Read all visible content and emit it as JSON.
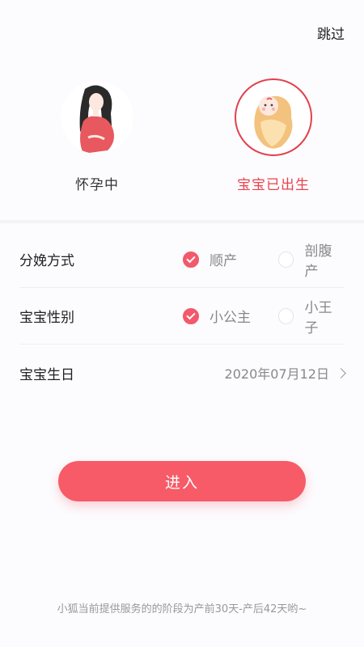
{
  "header": {
    "skip_label": "跳过"
  },
  "stages": {
    "pregnant": {
      "label": "怀孕中",
      "icon": "pregnant-woman-icon"
    },
    "born": {
      "label": "宝宝已出生",
      "icon": "swaddled-baby-icon"
    }
  },
  "form": {
    "delivery": {
      "label": "分娩方式",
      "option_a": "顺产",
      "option_b": "剖腹产",
      "selected": "顺产"
    },
    "gender": {
      "label": "宝宝性别",
      "option_a": "小公主",
      "option_b": "小王子",
      "selected": "小公主"
    },
    "birthday": {
      "label": "宝宝生日",
      "value": "2020年07月12日"
    }
  },
  "enter_label": "进入",
  "footer_text": "小狐当前提供服务的的阶段为产前30天-产后42天哟~",
  "colors": {
    "accent": "#f65b67",
    "selected_text": "#e8434f"
  }
}
